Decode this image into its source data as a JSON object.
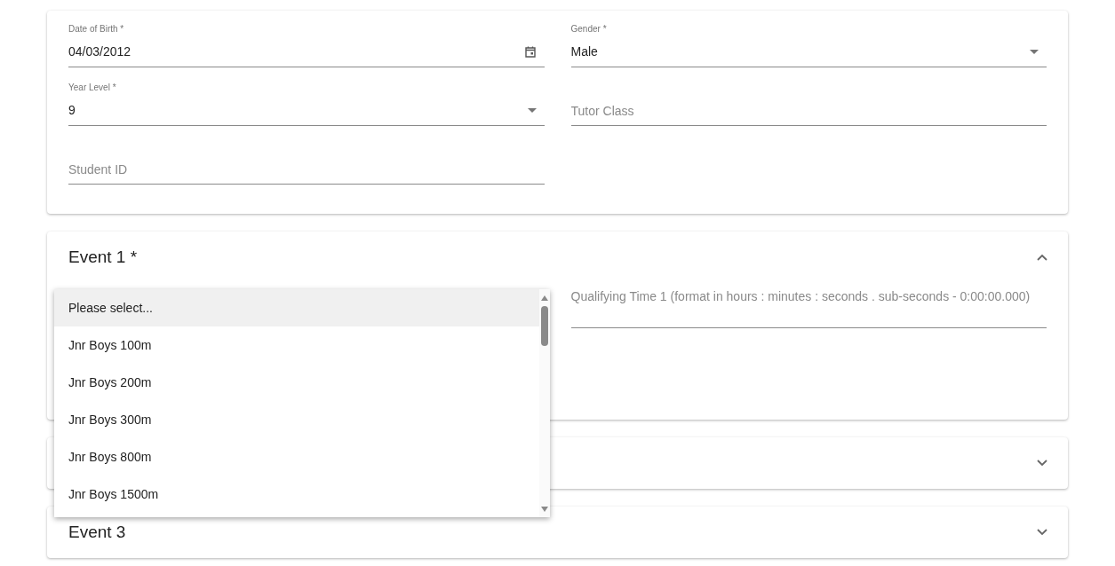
{
  "student_fields": [
    {
      "kind": "date",
      "label": "Date of Birth *",
      "value": "04/03/2012"
    },
    {
      "kind": "select",
      "label": "Gender *",
      "value": "Male"
    },
    {
      "kind": "select",
      "label": "Year Level *",
      "value": "9"
    },
    {
      "kind": "text",
      "placeholder": "Tutor Class"
    },
    {
      "kind": "text",
      "placeholder": "Student ID"
    }
  ],
  "events": [
    {
      "title": "Event 1 *",
      "expanded": true,
      "time_field": {
        "placeholder": "Qualifying Time 1 (format in hours : minutes : seconds . sub-seconds - 0:00:00.000)"
      }
    },
    {
      "expanded": false
    },
    {
      "title": "Event 3",
      "expanded": false
    }
  ],
  "dropdown": {
    "options": [
      {
        "label": "Please select...",
        "selected": true
      },
      {
        "label": "Jnr Boys 100m",
        "selected": false
      },
      {
        "label": "Jnr Boys 200m",
        "selected": false
      },
      {
        "label": "Jnr Boys 300m",
        "selected": false
      },
      {
        "label": "Jnr Boys 800m",
        "selected": false
      },
      {
        "label": "Jnr Boys 1500m",
        "selected": false
      }
    ]
  }
}
